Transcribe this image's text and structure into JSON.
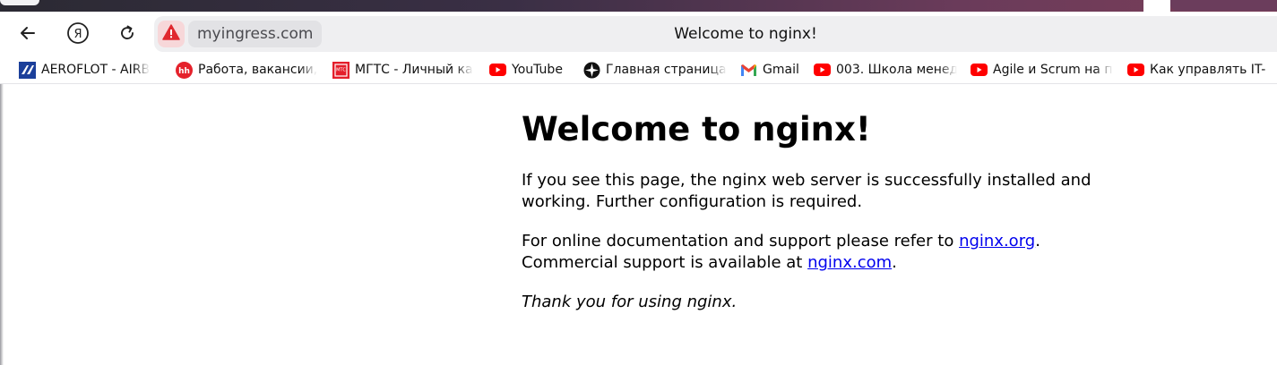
{
  "browser": {
    "address_domain": "myingress.com",
    "page_title": "Welcome to nginx!",
    "warning_icon": "warning-triangle-icon",
    "accent_warning": "#e0282f"
  },
  "nav": {
    "back_icon": "back-arrow-icon",
    "home_icon": "yandex-logo-icon",
    "reload_icon": "reload-icon"
  },
  "bookmarks": [
    {
      "label": "AEROFLOT - AIRB",
      "icon": "aeroflot-icon"
    },
    {
      "label": "Работа, вакансии,",
      "icon": "hh-icon"
    },
    {
      "label": "МГТС - Личный ка",
      "icon": "mgts-icon"
    },
    {
      "label": "YouTube",
      "icon": "youtube-icon"
    },
    {
      "label": "Главная страница",
      "icon": "wiki-icon"
    },
    {
      "label": "Gmail",
      "icon": "gmail-icon"
    },
    {
      "label": "003. Школа менед",
      "icon": "youtube-icon"
    },
    {
      "label": "Agile и Scrum на п",
      "icon": "youtube-icon"
    },
    {
      "label": "Как управлять IT-",
      "icon": "youtube-icon"
    }
  ],
  "page": {
    "heading": "Welcome to nginx!",
    "p1": "If you see this page, the nginx web server is successfully installed and working. Further configuration is required.",
    "p2_before": "For online documentation and support please refer to ",
    "p2_link1": "nginx.org",
    "p2_mid": ".",
    "p2_line2_before": "Commercial support is available at ",
    "p2_link2": "nginx.com",
    "p2_end": ".",
    "p3": "Thank you for using nginx.",
    "link_color": "#0000ee"
  }
}
